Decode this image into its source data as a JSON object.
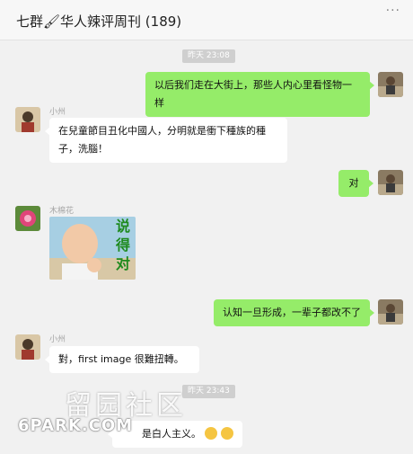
{
  "header": {
    "title": "七群🖌华人辣评周刊 (189)",
    "more": "···"
  },
  "messages": {
    "time1": "昨天 23:08",
    "m1": {
      "text": "以后我们走在大街上，那些人内心里看怪物一样"
    },
    "m2": {
      "sender": "小州",
      "line1": "在兒童節目丑化中國人，分明就是衝下種族的種",
      "line2": "子，洗腦！"
    },
    "m3": {
      "text": "对"
    },
    "m4": {
      "sender": "木棉花",
      "sticker_text": "说得对"
    },
    "m5": {
      "text": "认知一旦形成，一辈子都改不了"
    },
    "m6": {
      "sender": "小州",
      "text": "對，first image 很難扭轉。"
    },
    "time2": "昨天 23:43",
    "m7": {
      "text": "是白人主义。",
      "emojis": [
        "smile-emoji",
        "smile-emoji"
      ]
    }
  },
  "watermark": {
    "text": "留园社区",
    "sub": "6PARK.COM"
  },
  "colors": {
    "green_bubble": "#95ec69",
    "white_bubble": "#ffffff",
    "background": "#f1f1f1"
  }
}
